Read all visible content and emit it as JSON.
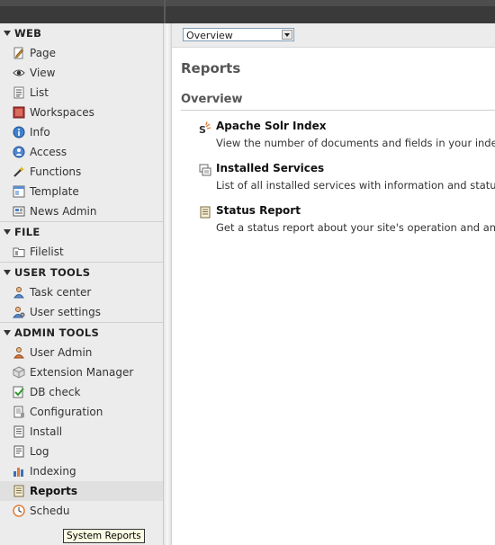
{
  "docheader": {
    "select_value": "Overview"
  },
  "sidebar": {
    "sections": [
      {
        "title": "WEB",
        "items": [
          {
            "label": "Page",
            "icon": "page-icon"
          },
          {
            "label": "View",
            "icon": "view-eye-icon"
          },
          {
            "label": "List",
            "icon": "list-icon"
          },
          {
            "label": "Workspaces",
            "icon": "workspaces-icon"
          },
          {
            "label": "Info",
            "icon": "info-icon"
          },
          {
            "label": "Access",
            "icon": "access-icon"
          },
          {
            "label": "Functions",
            "icon": "functions-wand-icon"
          },
          {
            "label": "Template",
            "icon": "template-icon"
          },
          {
            "label": "News Admin",
            "icon": "news-admin-icon"
          }
        ]
      },
      {
        "title": "FILE",
        "items": [
          {
            "label": "Filelist",
            "icon": "filelist-icon"
          }
        ]
      },
      {
        "title": "USER TOOLS",
        "items": [
          {
            "label": "Task center",
            "icon": "task-center-icon"
          },
          {
            "label": "User settings",
            "icon": "user-settings-icon"
          }
        ]
      },
      {
        "title": "ADMIN TOOLS",
        "items": [
          {
            "label": "User Admin",
            "icon": "user-admin-icon"
          },
          {
            "label": "Extension Manager",
            "icon": "extension-manager-icon"
          },
          {
            "label": "DB check",
            "icon": "db-check-icon"
          },
          {
            "label": "Configuration",
            "icon": "configuration-icon"
          },
          {
            "label": "Install",
            "icon": "install-icon"
          },
          {
            "label": "Log",
            "icon": "log-icon"
          },
          {
            "label": "Indexing",
            "icon": "indexing-chart-icon"
          },
          {
            "label": "Reports",
            "icon": "reports-icon"
          },
          {
            "label": "Schedu",
            "icon": "scheduler-icon"
          }
        ]
      }
    ],
    "tooltip": "System Reports"
  },
  "main": {
    "title": "Reports",
    "subtitle": "Overview",
    "reports": [
      {
        "title": "Apache Solr Index",
        "description": "View the number of documents and fields in your index",
        "icon": "solr-icon"
      },
      {
        "title": "Installed Services",
        "description": "List of all installed services with information and status f",
        "icon": "installed-services-icon"
      },
      {
        "title": "Status Report",
        "description": "Get a status report about your site's operation and any o",
        "icon": "status-report-icon"
      }
    ]
  },
  "colors": {
    "topbar": "#3a3a3a",
    "sidebar_bg": "#ececec",
    "text_heading": "#555555"
  }
}
